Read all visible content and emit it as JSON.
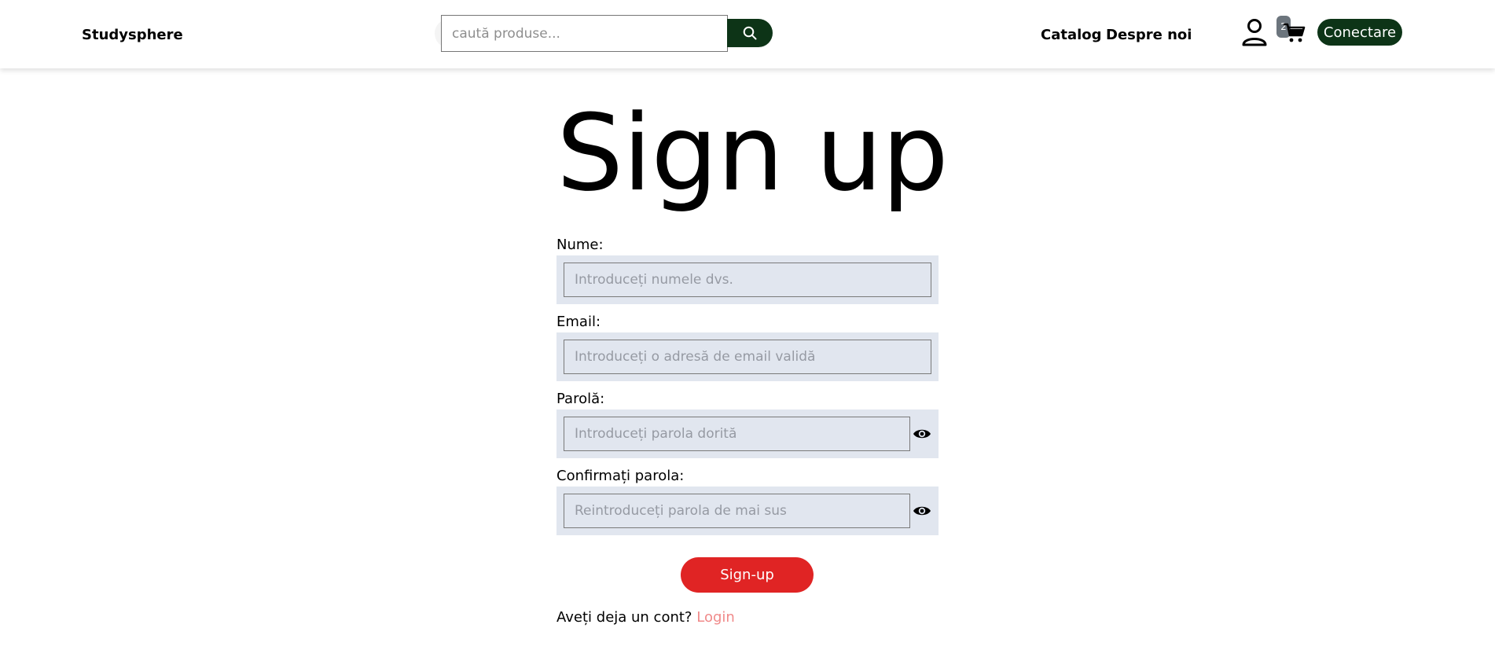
{
  "header": {
    "brand": "Studysphere",
    "search": {
      "placeholder": "caută produse...",
      "value": "",
      "button_icon": "search-icon"
    },
    "nav": {
      "catalog": "Catalog",
      "about": "Despre noi"
    },
    "user_icon": "user-icon",
    "cart": {
      "icon": "cart-icon",
      "count": "2"
    },
    "connect_label": "Conectare",
    "accent_color": "#0d3417"
  },
  "form": {
    "title": "Sign up",
    "fields": [
      {
        "label": "Nume:",
        "placeholder": "Introduceți numele dvs.",
        "value": ""
      },
      {
        "label": "Email:",
        "placeholder": "Introduceți o adresă de email validă",
        "value": ""
      },
      {
        "label": "Parolă:",
        "placeholder": "Introduceți parola dorită",
        "value": "",
        "toggle_icon": "eye-icon"
      },
      {
        "label": "Confirmați parola:",
        "placeholder": "Reintroduceți parola de mai sus",
        "value": "",
        "toggle_icon": "eye-icon"
      }
    ],
    "submit_label": "Sign-up",
    "submit_color": "#e02424",
    "footer": {
      "prompt": "Aveți deja un cont?",
      "link": "Login"
    }
  }
}
